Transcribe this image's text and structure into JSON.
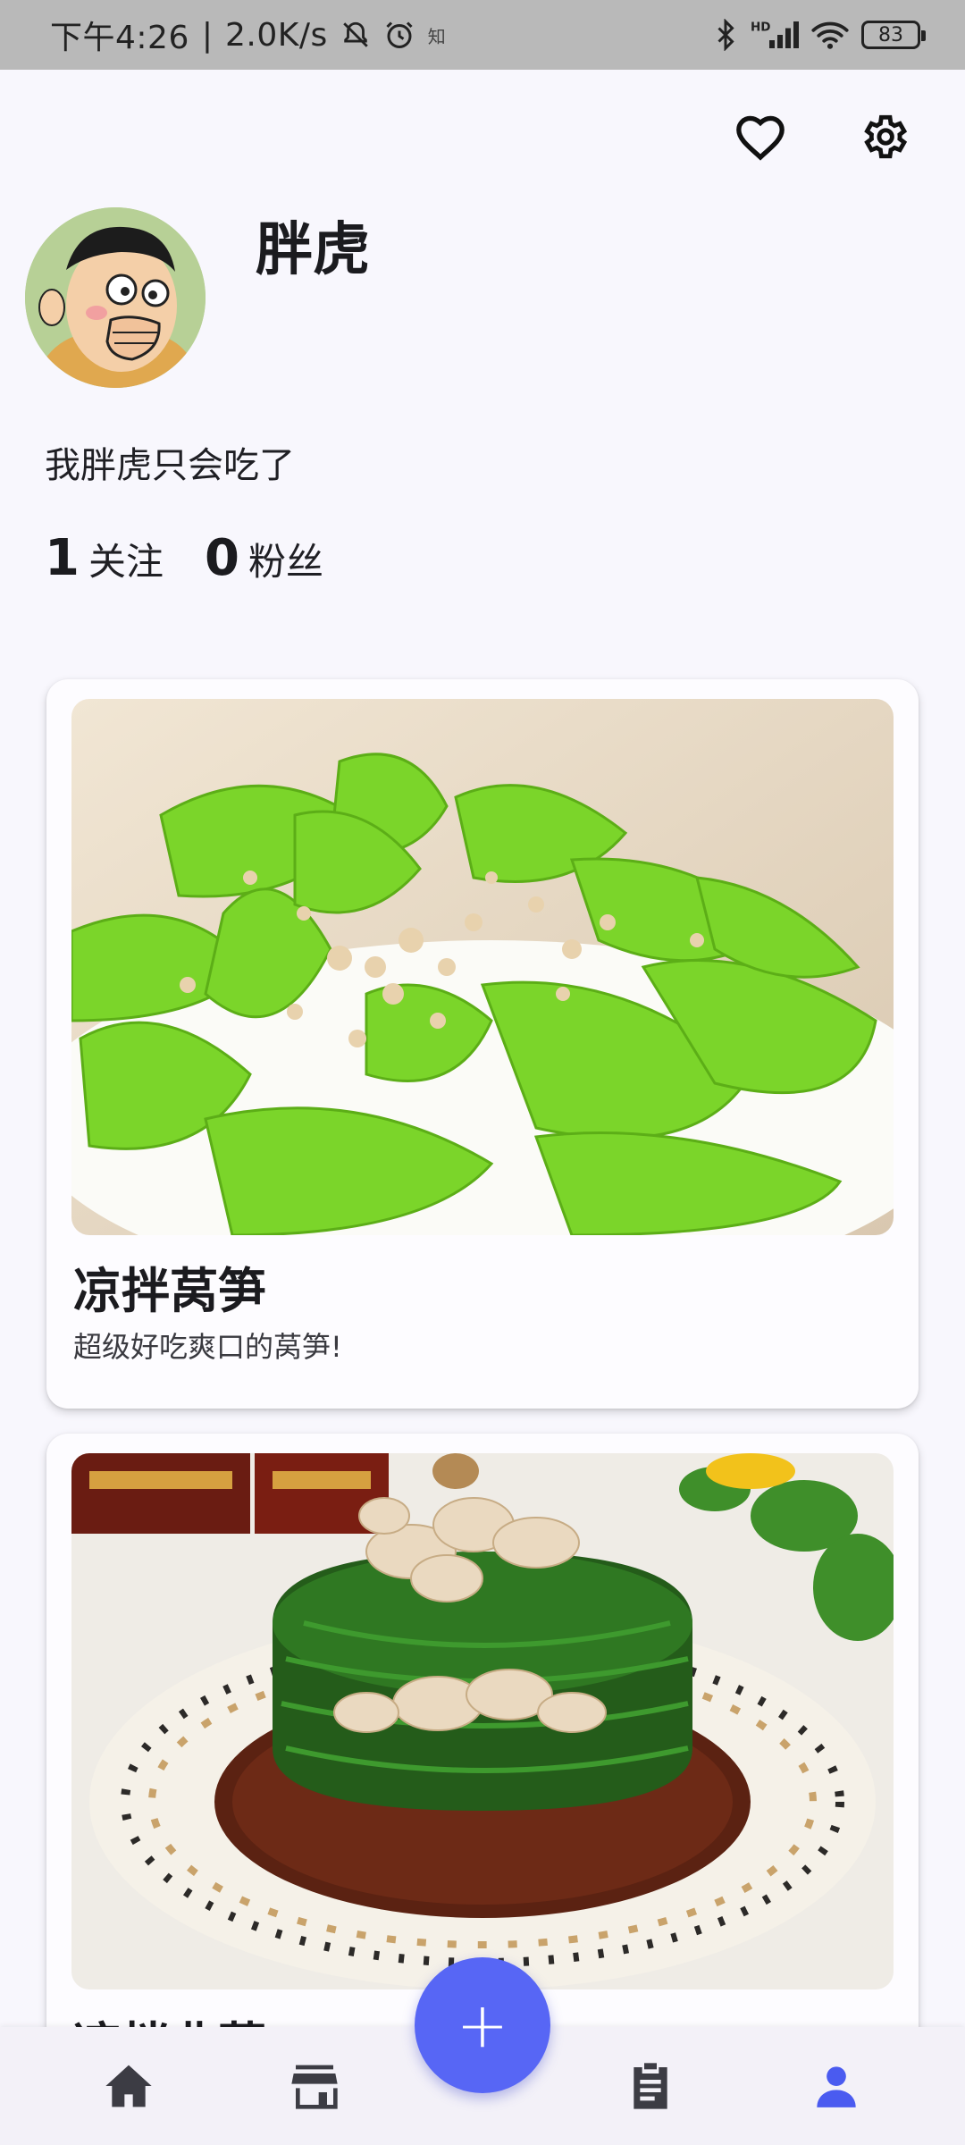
{
  "status_bar": {
    "time": "下午4:26",
    "speed": "2.0K/s",
    "app_mark": "知",
    "signal_label": "HD",
    "battery": "83"
  },
  "profile": {
    "username": "胖虎",
    "bio": "我胖虎只会吃了",
    "following_count": "1",
    "following_label": "关注",
    "followers_count": "0",
    "followers_label": "粉丝"
  },
  "posts": [
    {
      "title": "凉拌莴笋",
      "description": "超级好吃爽口的莴笋!"
    },
    {
      "title": "凉拌韭菜",
      "description": ""
    }
  ],
  "fab": {
    "label": "+"
  },
  "colors": {
    "accent": "#5766f5",
    "nav_active": "#4a5bf0",
    "nav_inactive": "#3c3c44"
  },
  "icons": {
    "favorite": "heart-outline-icon",
    "settings": "gear-icon",
    "nav": [
      "home-icon",
      "store-icon",
      "clipboard-icon",
      "person-icon"
    ]
  }
}
